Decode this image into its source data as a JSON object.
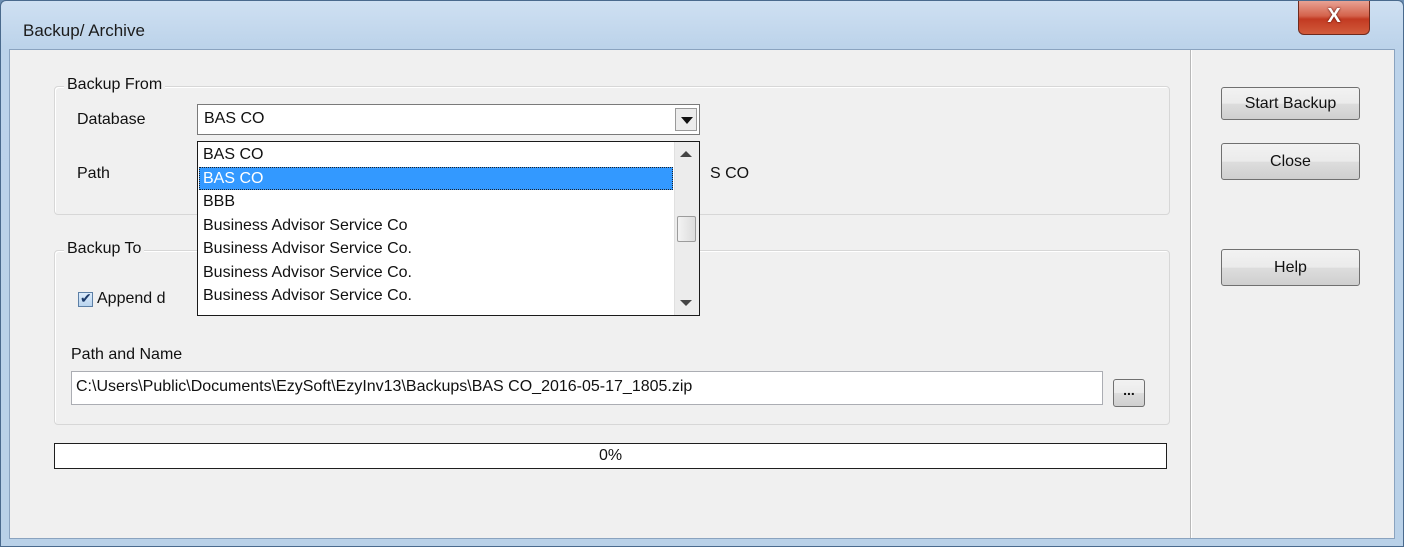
{
  "window": {
    "title": "Backup/ Archive",
    "close_icon_glyph": "X"
  },
  "backup_from": {
    "group_label": "Backup From",
    "database_label": "Database",
    "database_selected": "BAS CO",
    "path_label": "Path",
    "path_value_visible": "S CO",
    "dropdown_options": [
      "BAS CO",
      "BAS CO",
      "BBB",
      "Business Advisor Service Co",
      "Business Advisor Service Co.",
      "Business Advisor Service Co.",
      "Business Advisor Service Co."
    ],
    "dropdown_highlighted_index": 1
  },
  "backup_to": {
    "group_label": "Backup To",
    "append_label_visible": "Append d",
    "append_checked": true,
    "path_name_label": "Path and Name",
    "path_name_value": "C:\\Users\\Public\\Documents\\EzySoft\\EzyInv13\\Backups\\BAS CO_2016-05-17_1805.zip",
    "browse_label": "..."
  },
  "progress": {
    "percent": 0,
    "label": "0%"
  },
  "buttons": {
    "start_backup": "Start Backup",
    "close": "Close",
    "help": "Help"
  },
  "colors": {
    "close_button_red": "#c23a22",
    "selection_blue": "#3399ff",
    "title_bar_blue": "#bcd3ea"
  }
}
